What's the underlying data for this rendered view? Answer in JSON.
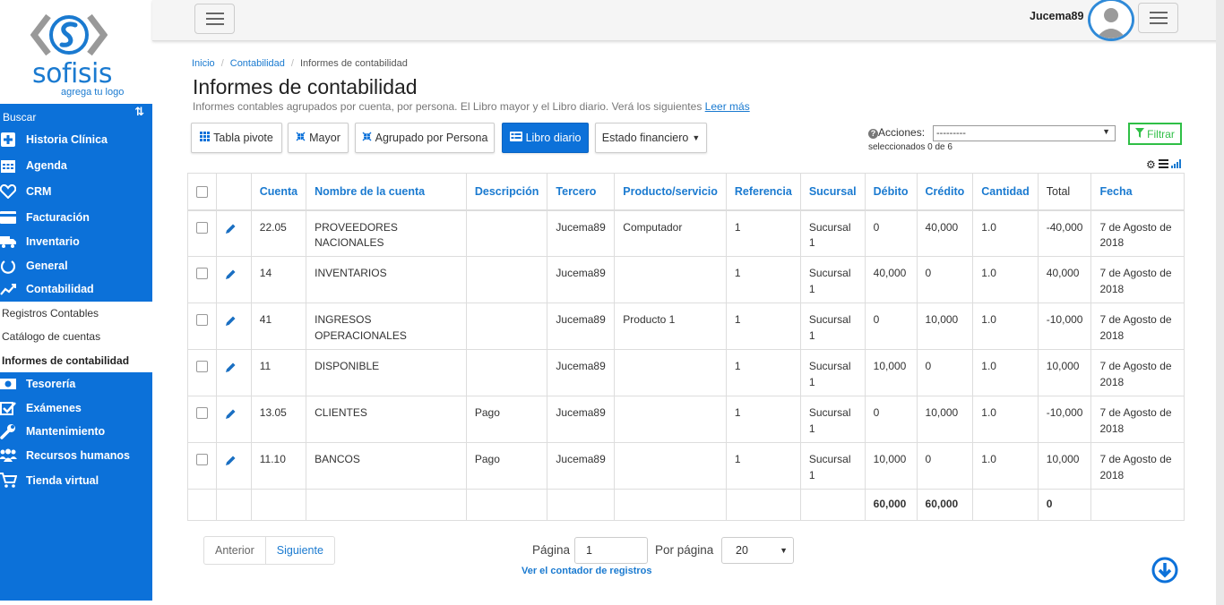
{
  "brand": {
    "name": "sofisis",
    "tagline": "agrega tu logo"
  },
  "sidebar": {
    "search_label": "Buscar",
    "items": [
      {
        "label": "Historia Clínica",
        "icon": "plus-square-icon"
      },
      {
        "label": "Agenda",
        "icon": "calendar-icon"
      },
      {
        "label": "CRM",
        "icon": "heart-icon"
      },
      {
        "label": "Facturación",
        "icon": "credit-card-icon"
      },
      {
        "label": "Inventario",
        "icon": "truck-icon"
      },
      {
        "label": "General",
        "icon": "power-icon"
      },
      {
        "label": "Contabilidad",
        "icon": "line-chart-icon"
      }
    ],
    "sub_items": [
      {
        "label": "Registros Contables"
      },
      {
        "label": "Catálogo de cuentas"
      },
      {
        "label": "Informes de contabilidad"
      }
    ],
    "items_after": [
      {
        "label": "Tesorería",
        "icon": "money-icon"
      },
      {
        "label": "Exámenes",
        "icon": "check-square-icon"
      },
      {
        "label": "Mantenimiento",
        "icon": "wrench-icon"
      },
      {
        "label": "Recursos humanos",
        "icon": "users-icon"
      },
      {
        "label": "Tienda virtual",
        "icon": "cart-icon"
      }
    ]
  },
  "header": {
    "username": "Jucema89"
  },
  "breadcrumb": [
    "Inicio",
    "Contabilidad",
    "Informes de contabilidad"
  ],
  "page": {
    "title": "Informes de contabilidad",
    "description": "Informes contables agrupados por cuenta, por persona. El Libro mayor y el Libro diario. Verá los siguientes",
    "read_more": "Leer más"
  },
  "toolbar": {
    "tabla_pivote": "Tabla pivote",
    "mayor": "Mayor",
    "agrupado": "Agrupado por Persona",
    "libro_diario": "Libro diario",
    "estado_financiero": "Estado financiero",
    "acciones_label": "Acciones:",
    "acciones_value": "---------",
    "selected_count": "seleccionados 0 de 6",
    "filtrar": "Filtrar"
  },
  "table": {
    "columns": [
      "Cuenta",
      "Nombre de la cuenta",
      "Descripción",
      "Tercero",
      "Producto/servicio",
      "Referencia",
      "Sucursal",
      "Débito",
      "Crédito",
      "Cantidad",
      "Total",
      "Fecha"
    ],
    "rows": [
      {
        "cuenta": "22.05",
        "nombre": "PROVEEDORES NACIONALES",
        "descripcion": "",
        "tercero": "Jucema89",
        "producto": "Computador",
        "referencia": "1",
        "sucursal": "Sucursal 1",
        "debito": "0",
        "credito": "40,000",
        "cantidad": "1.0",
        "total": "-40,000",
        "fecha": "7 de Agosto de 2018"
      },
      {
        "cuenta": "14",
        "nombre": "INVENTARIOS",
        "descripcion": "",
        "tercero": "Jucema89",
        "producto": "",
        "referencia": "1",
        "sucursal": "Sucursal 1",
        "debito": "40,000",
        "credito": "0",
        "cantidad": "1.0",
        "total": "40,000",
        "fecha": "7 de Agosto de 2018"
      },
      {
        "cuenta": "41",
        "nombre": "INGRESOS OPERACIONALES",
        "descripcion": "",
        "tercero": "Jucema89",
        "producto": "Producto 1",
        "referencia": "1",
        "sucursal": "Sucursal 1",
        "debito": "0",
        "credito": "10,000",
        "cantidad": "1.0",
        "total": "-10,000",
        "fecha": "7 de Agosto de 2018"
      },
      {
        "cuenta": "11",
        "nombre": "DISPONIBLE",
        "descripcion": "",
        "tercero": "Jucema89",
        "producto": "",
        "referencia": "1",
        "sucursal": "Sucursal 1",
        "debito": "10,000",
        "credito": "0",
        "cantidad": "1.0",
        "total": "10,000",
        "fecha": "7 de Agosto de 2018"
      },
      {
        "cuenta": "13.05",
        "nombre": "CLIENTES",
        "descripcion": "Pago",
        "tercero": "Jucema89",
        "producto": "",
        "referencia": "1",
        "sucursal": "Sucursal 1",
        "debito": "0",
        "credito": "10,000",
        "cantidad": "1.0",
        "total": "-10,000",
        "fecha": "7 de Agosto de 2018"
      },
      {
        "cuenta": "11.10",
        "nombre": "BANCOS",
        "descripcion": "Pago",
        "tercero": "Jucema89",
        "producto": "",
        "referencia": "1",
        "sucursal": "Sucursal 1",
        "debito": "10,000",
        "credito": "0",
        "cantidad": "1.0",
        "total": "10,000",
        "fecha": "7 de Agosto de 2018"
      }
    ],
    "totals": {
      "debito": "60,000",
      "credito": "60,000",
      "total": "0"
    }
  },
  "pagination": {
    "prev": "Anterior",
    "next": "Siguiente",
    "page_label": "Página",
    "page_value": "1",
    "per_page_label": "Por página",
    "per_page_value": "20",
    "counter_link": "Ver el contador de registros"
  },
  "colors": {
    "primary": "#0c71d9",
    "link": "#1a7ad0",
    "filter": "#2fbf46"
  }
}
